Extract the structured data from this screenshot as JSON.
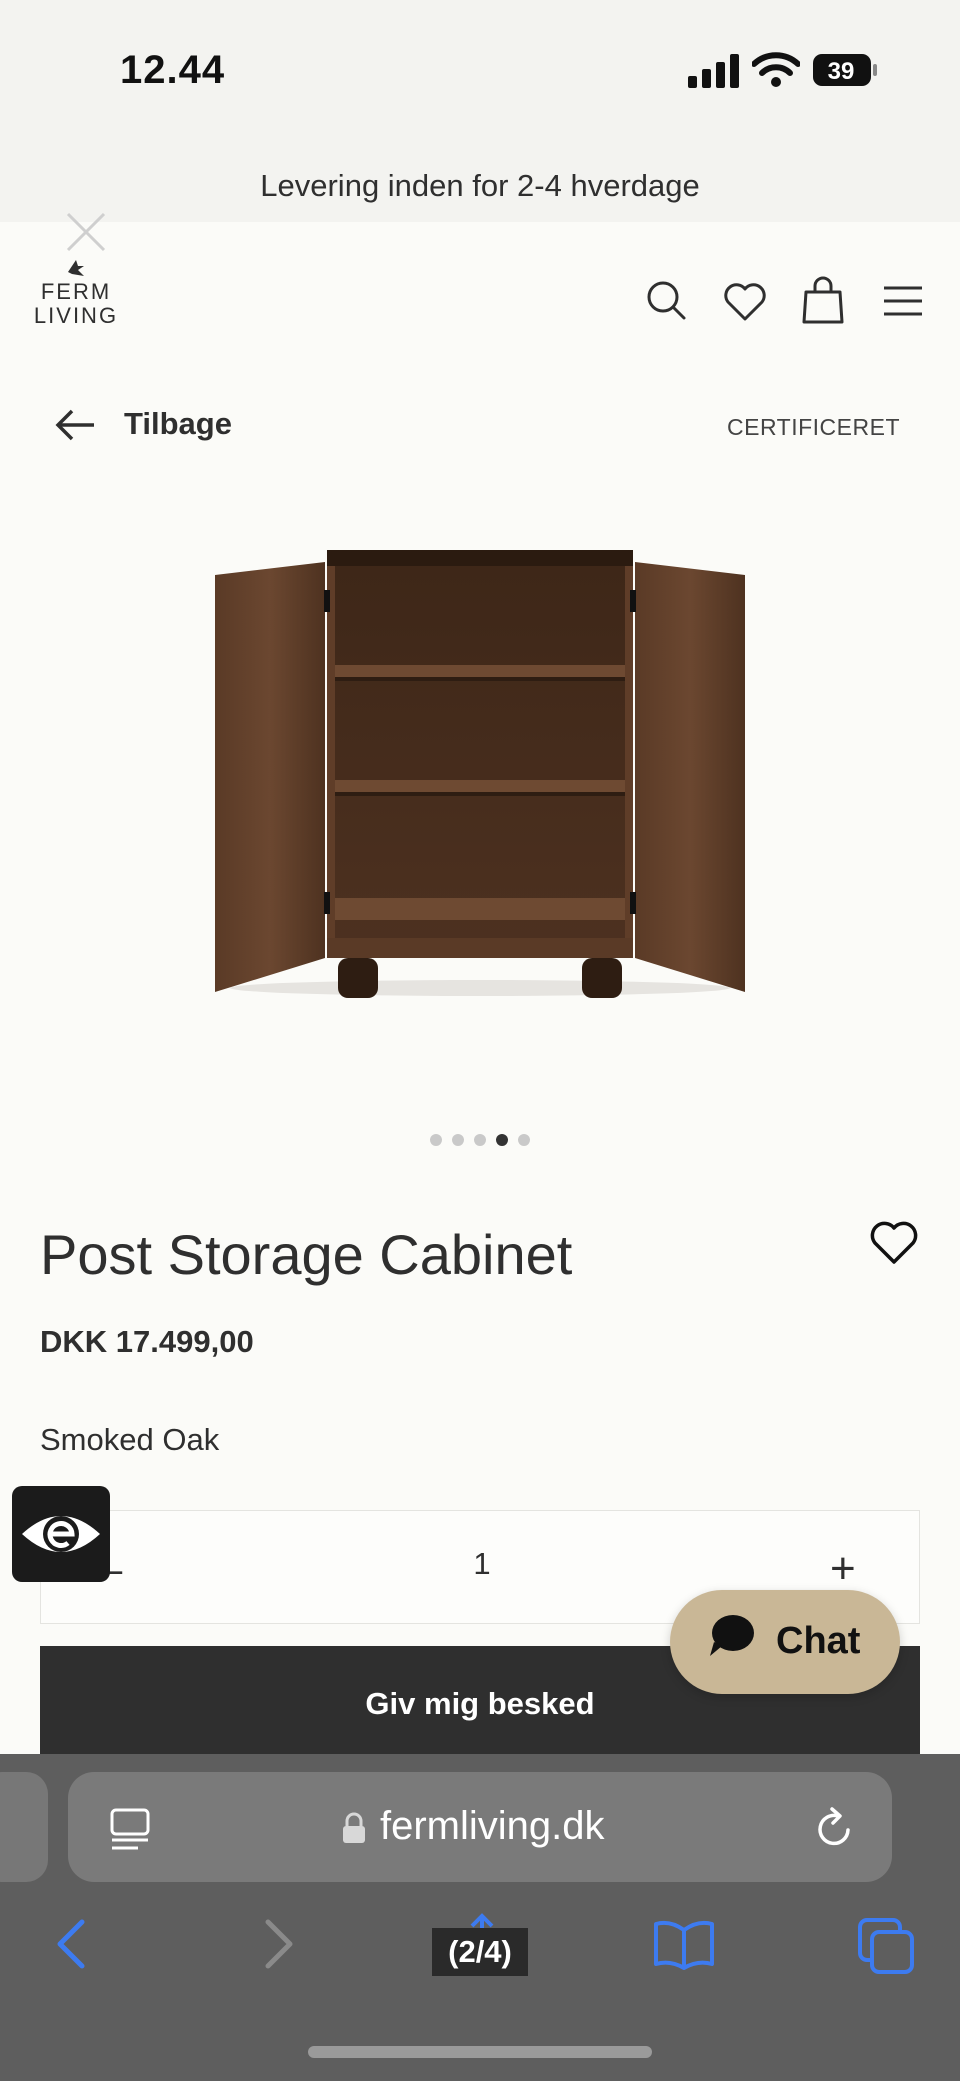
{
  "status_bar": {
    "time": "12.44",
    "battery": "39"
  },
  "promo_banner": {
    "text": "Levering inden for 2-4 hverdage"
  },
  "brand": {
    "line1": "FERM",
    "line2": "LIVING"
  },
  "nav": {
    "back_label": "Tilbage",
    "certified_label": "CERTIFICERET"
  },
  "gallery": {
    "total": 5,
    "active_index": 3
  },
  "product": {
    "title": "Post Storage Cabinet",
    "price": "DKK 17.499,00",
    "variant": "Smoked Oak",
    "quantity": "1",
    "qty_minus": "–",
    "qty_plus": "+",
    "notify_label": "Giv mig besked"
  },
  "chat": {
    "label": "Chat"
  },
  "browser": {
    "url": "fermliving.dk",
    "image_counter": "(2/4)"
  },
  "colors": {
    "background": "#fbfbf8",
    "banner": "#f3f3f0",
    "text": "#2f2f2f",
    "button": "#2f2f2f",
    "chat": "#c9b796",
    "toolbar": "#5e5e5e",
    "link_blue": "#3d7bf0"
  },
  "icons": [
    "signal-icon",
    "wifi-icon",
    "battery-icon",
    "close-icon",
    "search-icon",
    "heart-icon",
    "bag-icon",
    "menu-icon",
    "arrow-left-icon",
    "eye-icon",
    "chat-bubble-icon",
    "reader-icon",
    "lock-icon",
    "reload-icon",
    "chevron-left-icon",
    "chevron-right-icon",
    "share-icon",
    "bookmarks-icon",
    "tabs-icon"
  ]
}
